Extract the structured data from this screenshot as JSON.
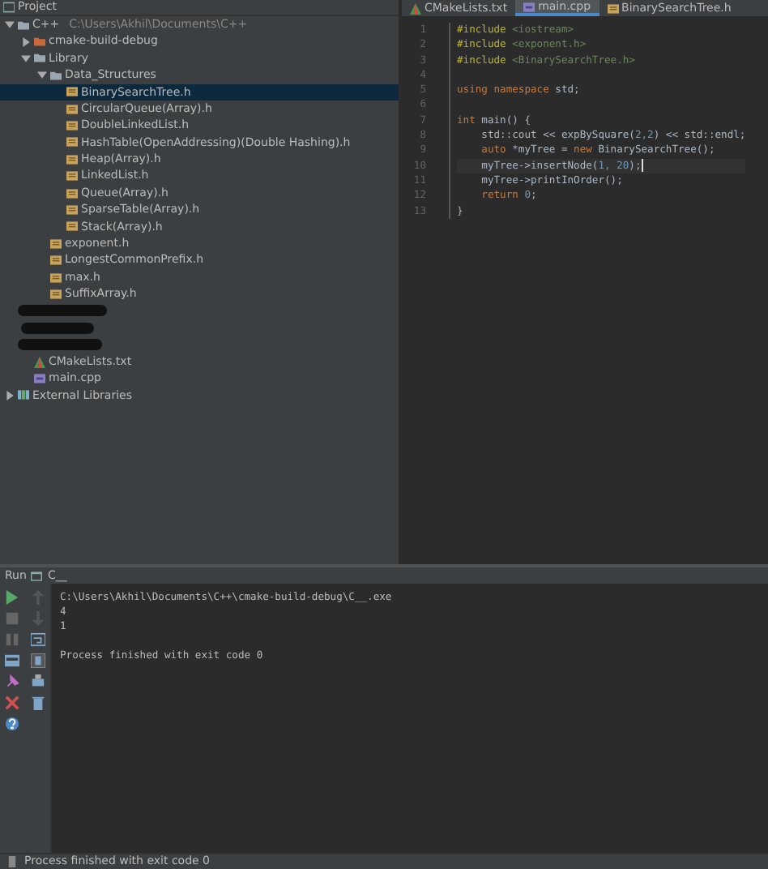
{
  "project_panel": {
    "title": "Project",
    "tree": [
      {
        "label": "C++",
        "path": "C:\\Users\\Akhil\\Documents\\C++",
        "kind": "folder",
        "expanded": true,
        "selected": false,
        "children": [
          {
            "label": "cmake-build-debug",
            "kind": "build",
            "expanded": false,
            "selected": false
          },
          {
            "label": "Library",
            "kind": "folder",
            "expanded": true,
            "selected": false,
            "children": [
              {
                "label": "Data_Structures",
                "kind": "folder",
                "expanded": true,
                "selected": false,
                "children": [
                  {
                    "label": "BinarySearchTree.h",
                    "kind": "header",
                    "selected": true
                  },
                  {
                    "label": "CircularQueue(Array).h",
                    "kind": "header",
                    "selected": false
                  },
                  {
                    "label": "DoubleLinkedList.h",
                    "kind": "header",
                    "selected": false
                  },
                  {
                    "label": "HashTable(OpenAddressing)(Double Hashing).h",
                    "kind": "header",
                    "selected": false
                  },
                  {
                    "label": "Heap(Array).h",
                    "kind": "header",
                    "selected": false
                  },
                  {
                    "label": "LinkedList.h",
                    "kind": "header",
                    "selected": false
                  },
                  {
                    "label": "Queue(Array).h",
                    "kind": "header",
                    "selected": false
                  },
                  {
                    "label": "SparseTable(Array).h",
                    "kind": "header",
                    "selected": false
                  },
                  {
                    "label": "Stack(Array).h",
                    "kind": "header",
                    "selected": false
                  }
                ]
              },
              {
                "label": "exponent.h",
                "kind": "header",
                "selected": false
              },
              {
                "label": "LongestCommonPrefix.h",
                "kind": "header",
                "selected": false
              },
              {
                "label": "max.h",
                "kind": "header",
                "selected": false
              },
              {
                "label": "SuffixArray.h",
                "kind": "header",
                "selected": false
              }
            ]
          },
          {
            "kind": "redacted"
          },
          {
            "kind": "redacted"
          },
          {
            "kind": "redacted"
          },
          {
            "label": "CMakeLists.txt",
            "kind": "cmake",
            "selected": false
          },
          {
            "label": "main.cpp",
            "kind": "cpp",
            "selected": false
          }
        ]
      },
      {
        "label": "External Libraries",
        "kind": "library",
        "expanded": false,
        "selected": false
      }
    ]
  },
  "editor": {
    "tabs": [
      {
        "label": "CMakeLists.txt",
        "kind": "cmake",
        "selected": false
      },
      {
        "label": "main.cpp",
        "kind": "cpp",
        "selected": true
      },
      {
        "label": "BinarySearchTree.h",
        "kind": "header",
        "selected": false
      }
    ],
    "lines": [
      {
        "number": "1",
        "tokens": [
          {
            "kind": "pp",
            "t": "#include"
          },
          {
            "kind": "str",
            "t": " <iostream>"
          }
        ]
      },
      {
        "number": "2",
        "tokens": [
          {
            "kind": "pp",
            "t": "#include"
          },
          {
            "kind": "str",
            "t": " <exponent.h>"
          }
        ]
      },
      {
        "number": "3",
        "tokens": [
          {
            "kind": "pp",
            "t": "#include"
          },
          {
            "kind": "str",
            "t": " <BinarySearchTree.h>"
          }
        ]
      },
      {
        "number": "4"
      },
      {
        "number": "5",
        "tokens": [
          {
            "kind": "kw",
            "t": "using namespace"
          },
          {
            "kind": "id",
            "t": " std;"
          }
        ]
      },
      {
        "number": "6"
      },
      {
        "number": "7",
        "tokens": [
          {
            "kind": "kw",
            "t": "int"
          },
          {
            "kind": "id",
            "t": " main() {"
          }
        ]
      },
      {
        "number": "8",
        "tokens": [
          {
            "kind": "id",
            "t": "    std::cout << expBySquare("
          },
          {
            "kind": "num",
            "t": "2,2"
          },
          {
            "kind": "id",
            "t": ") << std::endl;"
          }
        ]
      },
      {
        "number": "9",
        "tokens": [
          {
            "kind": "kw",
            "t": "    auto"
          },
          {
            "kind": "id",
            "t": " *myTree = "
          },
          {
            "kind": "kw",
            "t": "new"
          },
          {
            "kind": "id",
            "t": " BinarySearchTree();"
          }
        ]
      },
      {
        "number": "10",
        "current": true,
        "tokens": [
          {
            "kind": "id",
            "t": "    myTree->insertNode("
          },
          {
            "kind": "num",
            "t": "1, 20"
          },
          {
            "kind": "id",
            "t": ");"
          }
        ]
      },
      {
        "number": "11",
        "tokens": [
          {
            "kind": "id",
            "t": "    myTree->printInOrder();"
          }
        ]
      },
      {
        "number": "12",
        "tokens": [
          {
            "kind": "kw",
            "t": "    return"
          },
          {
            "kind": "num",
            "t": " 0"
          },
          {
            "kind": "id",
            "t": ";"
          }
        ]
      },
      {
        "number": "13",
        "tokens": [
          {
            "kind": "id",
            "t": "}"
          }
        ]
      }
    ]
  },
  "run_panel": {
    "title": "Run",
    "config": "C__",
    "output": [
      {
        "kind": "line",
        "text": "C:\\Users\\Akhil\\Documents\\C++\\cmake-build-debug\\C__.exe"
      },
      {
        "kind": "line",
        "text": "4"
      },
      {
        "kind": "line",
        "text": "1"
      },
      {
        "kind": "blank"
      },
      {
        "kind": "line",
        "text": "Process finished with exit code 0"
      }
    ]
  },
  "status_bar": {
    "text": "Process finished with exit code 0"
  }
}
